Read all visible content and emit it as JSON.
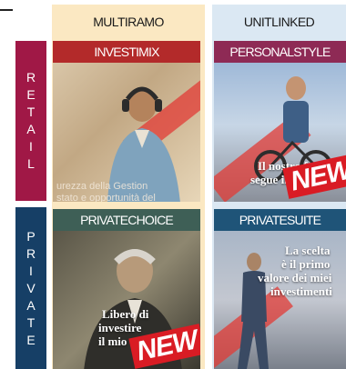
{
  "columns": {
    "multiramo": "MULTIRAMO",
    "unitlinked": "UNITLINKED"
  },
  "rows": {
    "retail": [
      "R",
      "E",
      "T",
      "A",
      "I",
      "L"
    ],
    "private": [
      "P",
      "R",
      "I",
      "V",
      "A",
      "T",
      "E"
    ]
  },
  "cards": {
    "investimix": {
      "title": "INVESTIMIX",
      "caption_line1": "urezza della Gestion",
      "caption_line2": "stato e opportunità del"
    },
    "personalstyle": {
      "title": "PERSONALSTYLE",
      "caption_line1": "Il nostro futuro,",
      "caption_line2": "segue il mio stile",
      "badge": "NEW"
    },
    "privatechoice": {
      "title": "PRIVATECHOICE",
      "caption_line1": "Libero di",
      "caption_line2": "investire",
      "caption_line3": "il mio",
      "badge": "NEW"
    },
    "privatesuite": {
      "title": "PRIVATESUITE",
      "caption_line1": "La scelta",
      "caption_line2": "è il primo",
      "caption_line3": "valore dei miei",
      "caption_line4": "investimenti"
    }
  },
  "colors": {
    "retail": "#a01846",
    "private": "#163f66",
    "multiramo_bg": "#fbe8c2",
    "unitlinked_bg": "#dbe8f3",
    "accent_red": "#e23b36"
  }
}
